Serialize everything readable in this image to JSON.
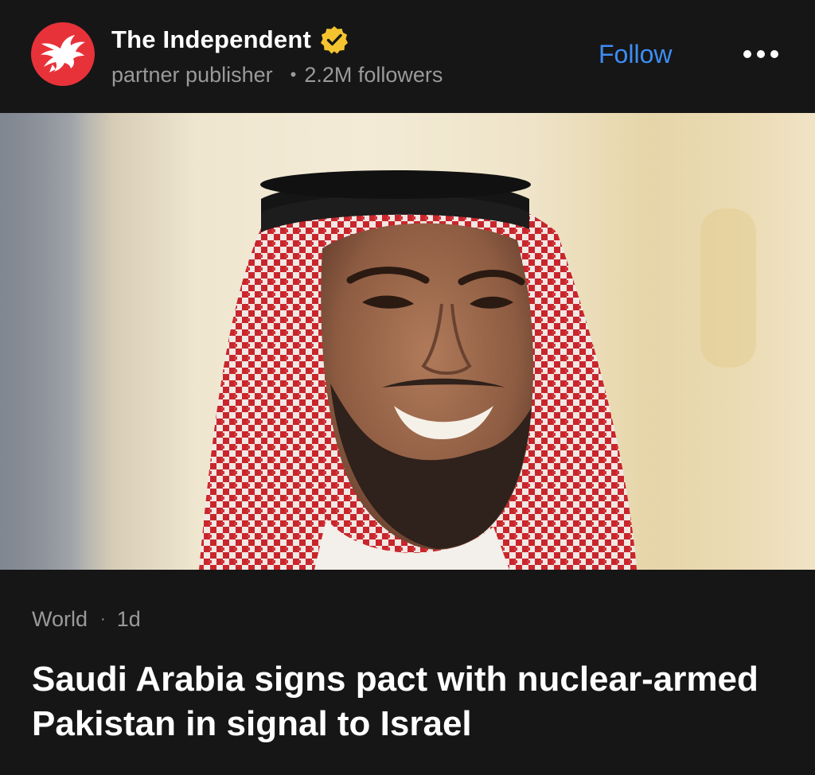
{
  "publisher": {
    "name": "The Independent",
    "label": "partner publisher",
    "followers": "2.2M followers",
    "logo_color": "#e8323a",
    "verified_icon": "verified-badge-icon"
  },
  "actions": {
    "follow_label": "Follow",
    "more_icon": "more-options-icon"
  },
  "article": {
    "category": "World",
    "age": "1d",
    "headline": "Saudi Arabia signs pact with nuclear-armed Pakistan in signal to Israel"
  },
  "colors": {
    "background": "#161616",
    "accent": "#3d8df5",
    "secondary_text": "#9a9a9a"
  }
}
